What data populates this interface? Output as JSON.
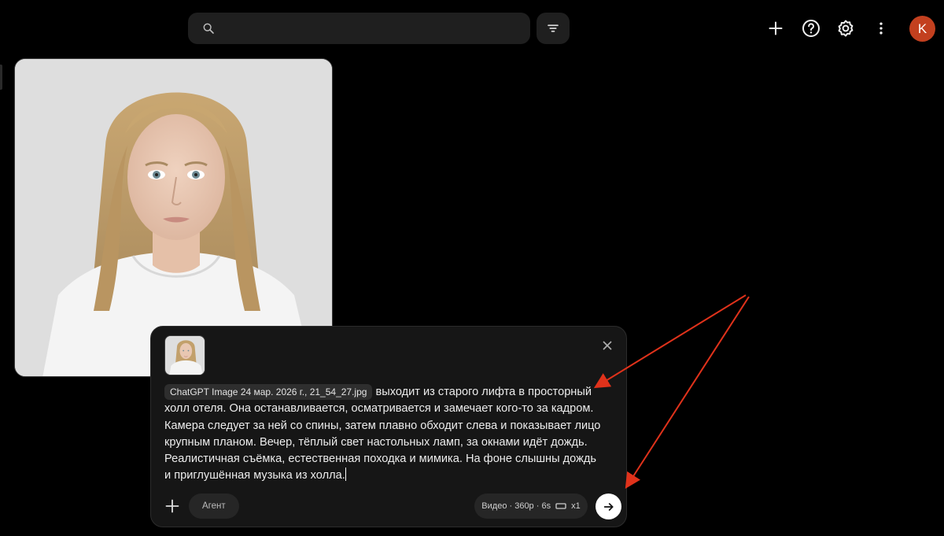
{
  "header": {
    "search_placeholder": "",
    "icons": [
      "search-icon",
      "filter-icon",
      "plus-icon",
      "help-icon",
      "settings-icon",
      "more-vert-icon"
    ],
    "avatar_letter": "K",
    "avatar_color": "#c3401f"
  },
  "prompt": {
    "attachment_chip": "ChatGPT Image 24 мар. 2026 г., 21_54_27.jpg",
    "text": "выходит из старого лифта в просторный холл отеля. Она останавливается, осматривается и замечает кого-то за кадром. Камера следует за ней со спины, затем плавно обходит слева и показывает лицо крупным планом. Вечер, тёплый свет настольных ламп, за окнами идёт дождь. Реалистичная съёмка, естественная походка и мимика. На фоне слышны дождь и приглушённая музыка из холла.",
    "agent_label": "Агент",
    "settings_label": "Видео · 360p · 6s",
    "multiplier_label": "x1"
  },
  "colors": {
    "background": "#000000",
    "panel": "#161616",
    "annotation_arrow": "#e0321b"
  }
}
